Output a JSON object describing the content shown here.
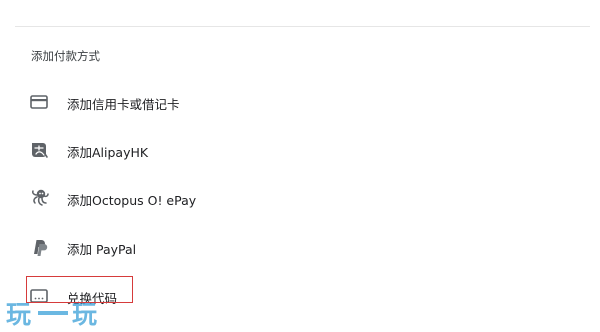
{
  "section": {
    "title": "添加付款方式"
  },
  "payment_options": [
    {
      "label": "添加信用卡或借记卡",
      "icon": "credit-card-icon"
    },
    {
      "label": "添加AlipayHK",
      "icon": "alipayhk-icon"
    },
    {
      "label": "添加Octopus O! ePay",
      "icon": "octopus-icon"
    },
    {
      "label": "添加 PayPal",
      "icon": "paypal-icon"
    },
    {
      "label": "兑换代码",
      "icon": "redeem-code-icon"
    }
  ],
  "watermark": {
    "text": "玩一玩"
  },
  "colors": {
    "highlight": "#d63b3b",
    "icon": "#5f6368",
    "watermark": "#3aa0d8"
  }
}
